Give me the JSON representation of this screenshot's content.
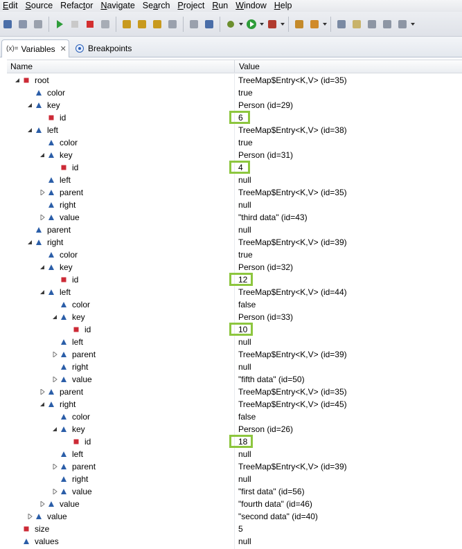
{
  "menu": [
    "Edit",
    "Source",
    "Refactor",
    "Navigate",
    "Search",
    "Project",
    "Run",
    "Window",
    "Help"
  ],
  "menu_mnemonics": [
    "E",
    "S",
    "t",
    "N",
    "a",
    "P",
    "R",
    "W",
    "H"
  ],
  "tabs": {
    "variables": {
      "icon": "(x)=",
      "label": "Variables",
      "close": "✕"
    },
    "breakpoints": {
      "label": "Breakpoints"
    }
  },
  "columns": {
    "name": "Name",
    "value": "Value"
  },
  "tree": [
    {
      "depth": 2,
      "name": "root",
      "value": "TreeMap$Entry<K,V>  (id=35)",
      "exp": "open",
      "icon": "field-private"
    },
    {
      "depth": 3,
      "name": "color",
      "value": "true",
      "exp": "none",
      "icon": "field"
    },
    {
      "depth": 3,
      "name": "key",
      "value": "Person  (id=29)",
      "exp": "open",
      "icon": "field"
    },
    {
      "depth": 4,
      "name": "id",
      "value": "6",
      "exp": "none",
      "icon": "field-private",
      "highlight": true
    },
    {
      "depth": 3,
      "name": "left",
      "value": "TreeMap$Entry<K,V>  (id=38)",
      "exp": "open",
      "icon": "field"
    },
    {
      "depth": 4,
      "name": "color",
      "value": "true",
      "exp": "none",
      "icon": "field"
    },
    {
      "depth": 4,
      "name": "key",
      "value": "Person  (id=31)",
      "exp": "open",
      "icon": "field"
    },
    {
      "depth": 5,
      "name": "id",
      "value": "4",
      "exp": "none",
      "icon": "field-private",
      "highlight": true
    },
    {
      "depth": 4,
      "name": "left",
      "value": "null",
      "exp": "none",
      "icon": "field"
    },
    {
      "depth": 4,
      "name": "parent",
      "value": "TreeMap$Entry<K,V>  (id=35)",
      "exp": "closed",
      "icon": "field"
    },
    {
      "depth": 4,
      "name": "right",
      "value": "null",
      "exp": "none",
      "icon": "field"
    },
    {
      "depth": 4,
      "name": "value",
      "value": "\"third data\" (id=43)",
      "exp": "closed",
      "icon": "field"
    },
    {
      "depth": 3,
      "name": "parent",
      "value": "null",
      "exp": "none",
      "icon": "field"
    },
    {
      "depth": 3,
      "name": "right",
      "value": "TreeMap$Entry<K,V>  (id=39)",
      "exp": "open",
      "icon": "field"
    },
    {
      "depth": 4,
      "name": "color",
      "value": "true",
      "exp": "none",
      "icon": "field"
    },
    {
      "depth": 4,
      "name": "key",
      "value": "Person  (id=32)",
      "exp": "open",
      "icon": "field"
    },
    {
      "depth": 5,
      "name": "id",
      "value": "12",
      "exp": "none",
      "icon": "field-private",
      "highlight": true
    },
    {
      "depth": 4,
      "name": "left",
      "value": "TreeMap$Entry<K,V>  (id=44)",
      "exp": "open",
      "icon": "field"
    },
    {
      "depth": 5,
      "name": "color",
      "value": "false",
      "exp": "none",
      "icon": "field"
    },
    {
      "depth": 5,
      "name": "key",
      "value": "Person  (id=33)",
      "exp": "open",
      "icon": "field"
    },
    {
      "depth": 6,
      "name": "id",
      "value": "10",
      "exp": "none",
      "icon": "field-private",
      "highlight": true
    },
    {
      "depth": 5,
      "name": "left",
      "value": "null",
      "exp": "none",
      "icon": "field"
    },
    {
      "depth": 5,
      "name": "parent",
      "value": "TreeMap$Entry<K,V>  (id=39)",
      "exp": "closed",
      "icon": "field"
    },
    {
      "depth": 5,
      "name": "right",
      "value": "null",
      "exp": "none",
      "icon": "field"
    },
    {
      "depth": 5,
      "name": "value",
      "value": "\"fifth data\" (id=50)",
      "exp": "closed",
      "icon": "field"
    },
    {
      "depth": 4,
      "name": "parent",
      "value": "TreeMap$Entry<K,V>  (id=35)",
      "exp": "closed",
      "icon": "field"
    },
    {
      "depth": 4,
      "name": "right",
      "value": "TreeMap$Entry<K,V>  (id=45)",
      "exp": "open",
      "icon": "field"
    },
    {
      "depth": 5,
      "name": "color",
      "value": "false",
      "exp": "none",
      "icon": "field"
    },
    {
      "depth": 5,
      "name": "key",
      "value": "Person  (id=26)",
      "exp": "open",
      "icon": "field"
    },
    {
      "depth": 6,
      "name": "id",
      "value": "18",
      "exp": "none",
      "icon": "field-private",
      "highlight": true
    },
    {
      "depth": 5,
      "name": "left",
      "value": "null",
      "exp": "none",
      "icon": "field"
    },
    {
      "depth": 5,
      "name": "parent",
      "value": "TreeMap$Entry<K,V>  (id=39)",
      "exp": "closed",
      "icon": "field"
    },
    {
      "depth": 5,
      "name": "right",
      "value": "null",
      "exp": "none",
      "icon": "field"
    },
    {
      "depth": 5,
      "name": "value",
      "value": "\"first data\" (id=56)",
      "exp": "closed",
      "icon": "field"
    },
    {
      "depth": 4,
      "name": "value",
      "value": "\"fourth data\" (id=46)",
      "exp": "closed",
      "icon": "field"
    },
    {
      "depth": 3,
      "name": "value",
      "value": "\"second data\" (id=40)",
      "exp": "closed",
      "icon": "field"
    },
    {
      "depth": 2,
      "name": "size",
      "value": "5",
      "exp": "none",
      "icon": "field-private"
    },
    {
      "depth": 2,
      "name": "values",
      "value": "null",
      "exp": "none",
      "icon": "field"
    }
  ],
  "colors": {
    "highlight": "#8dc63f",
    "field_icon": "#2b5ea8",
    "private_icon": "#cc2a36"
  },
  "toolbar_icons": [
    "save-icon",
    "save-all-icon",
    "print-icon",
    "resume-icon",
    "suspend-icon",
    "terminate-icon",
    "disconnect-icon",
    "step-into-icon",
    "step-over-icon",
    "step-return-icon",
    "drop-to-frame-icon",
    "use-step-filters-icon",
    "skip-breakpoints-icon",
    "debug-icon",
    "run-icon",
    "external-tools-icon",
    "new-package-icon",
    "search-icon",
    "toggle-breakpoint-icon",
    "toggle-mark-occurrences-icon",
    "show-whitespace-icon",
    "block-selection-icon",
    "next-annotation-icon"
  ]
}
